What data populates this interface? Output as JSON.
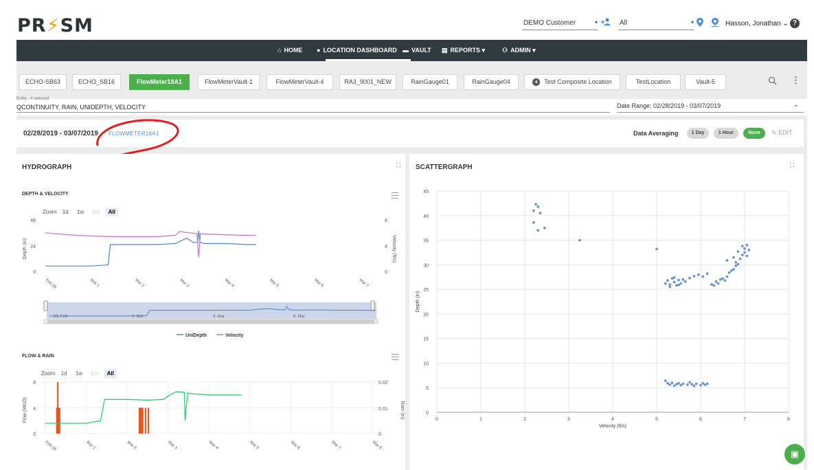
{
  "header": {
    "logo": "PR",
    "logo_bolt": "⚡",
    "logo_tail": "SM",
    "customer": "DEMO Customer",
    "filter": "All",
    "user": "Hasson, Jonathan",
    "user_caret": "⌄",
    "help": "?"
  },
  "nav": {
    "items": [
      {
        "label": "HOME",
        "icon": "home-icon"
      },
      {
        "label": "LOCATION DASHBOARD",
        "icon": "location-pin-icon"
      },
      {
        "label": "VAULT",
        "icon": "folder-icon"
      },
      {
        "label": "REPORTS",
        "icon": "report-icon"
      },
      {
        "label": "ADMIN",
        "icon": "admin-icon"
      }
    ]
  },
  "tabs": [
    "ECHO-SB63",
    "ECHO_SB16",
    "FlowMeter18A1",
    "FlowMeterVault-1",
    "FlowMeterVault-4",
    "RA3_9001_NEW",
    "RainGauge01",
    "RainGauge04",
    "Test Composite Location",
    "TestLocation",
    "Vault-5"
  ],
  "active_tab": "FlowMeter18A1",
  "entity": {
    "label": "Entity : 4 selected",
    "value": "QCONTINUITY, RAIN, UNIDEPTH, VELOCITY"
  },
  "date_range_field": "Date Range: 02/28/2019 - 03/07/2019",
  "infobar": {
    "date": "02/28/2019 - 03/07/2019",
    "location": "FLOWMETER18A1",
    "averaging_label": "Data Averaging",
    "pills": [
      "1 Day",
      "1 Hour",
      "None"
    ],
    "active_pill": "None",
    "edit": "EDIT"
  },
  "hydrograph": {
    "title": "HYDROGRAPH",
    "depth_velocity": {
      "title": "DEPTH & VELOCITY",
      "zoom_label": "Zoom",
      "zoom_options": [
        "1d",
        "1w",
        "1m",
        "All"
      ],
      "y_left_label": "Depth (in)",
      "y_right_label": "Velocity (ft/s)",
      "y_left_ticks": [
        "48",
        "24",
        "0"
      ],
      "y_right_ticks": [
        "8",
        "4",
        "0"
      ],
      "x_ticks": [
        "Feb 28",
        "Mar 1",
        "Mar 2",
        "Mar 3",
        "Mar 4",
        "Mar 5",
        "Mar 6",
        "Mar 7"
      ],
      "navigator_labels": [
        "28. Feb",
        "2. Mar",
        "4. Mar",
        "6. Mar"
      ],
      "legend": [
        "UniDepth",
        "Velocity"
      ]
    },
    "flow_rain": {
      "title": "FLOW & RAIN",
      "zoom_label": "Zoom",
      "zoom_options": [
        "1d",
        "1w",
        "1m",
        "All"
      ],
      "y_left_label": "Flow (MGD)",
      "y_right_label": "Rain (in)",
      "y_left_ticks": [
        "8",
        "4",
        "0"
      ],
      "y_right_ticks": [
        "0.02",
        "0.01",
        "0"
      ],
      "x_ticks": [
        "Feb 28",
        "Mar 1",
        "Mar 2",
        "Mar 3",
        "Mar 4",
        "Mar 5",
        "Mar 6",
        "Mar 7",
        "Mar 8"
      ]
    }
  },
  "scattergraph": {
    "title": "SCATTERGRAPH"
  },
  "colors": {
    "depth": "#4a86c8",
    "velocity": "#c86ec8",
    "flow": "#2ecc71",
    "rain": "#e8541e",
    "scatter": "#6f94c9",
    "green": "#4cae4c",
    "nav": "#2f3b41"
  },
  "chart_data": [
    {
      "type": "line",
      "title": "DEPTH & VELOCITY",
      "xlabel": "",
      "ylabel": "Depth (in)",
      "y2label": "Velocity (ft/s)",
      "x_ticks": [
        "Feb 28",
        "Mar 1",
        "Mar 2",
        "Mar 3",
        "Mar 4",
        "Mar 5",
        "Mar 6",
        "Mar 7"
      ],
      "ylim": [
        0,
        48
      ],
      "y2lim": [
        0,
        8
      ],
      "series": [
        {
          "name": "UniDepth",
          "axis": "left",
          "x": [
            0,
            0.5,
            1.0,
            1.4,
            1.45,
            2.0,
            2.5,
            2.9,
            3.0,
            3.15,
            3.3,
            3.4,
            3.42,
            3.45,
            3.55,
            4.0,
            4.5,
            4.7
          ],
          "y": [
            5,
            5,
            5,
            6,
            25,
            25,
            25,
            26,
            28,
            31,
            27,
            27,
            38,
            27,
            26,
            26,
            25,
            25
          ]
        },
        {
          "name": "Velocity",
          "axis": "right",
          "x": [
            0,
            0.5,
            1.0,
            1.5,
            2.0,
            2.5,
            2.9,
            3.0,
            3.2,
            3.38,
            3.42,
            3.46,
            3.55,
            4.0,
            4.5,
            4.7
          ],
          "y": [
            6.0,
            5.7,
            5.5,
            5.4,
            5.4,
            5.4,
            5.6,
            6.2,
            6.0,
            5.9,
            2.2,
            5.9,
            5.8,
            5.7,
            5.6,
            5.6
          ]
        }
      ]
    },
    {
      "type": "line",
      "title": "FLOW & RAIN",
      "xlabel": "",
      "ylabel": "Flow (MGD)",
      "y2label": "Rain (in)",
      "x_ticks": [
        "Feb 28",
        "Mar 1",
        "Mar 2",
        "Mar 3",
        "Mar 4",
        "Mar 5",
        "Mar 6",
        "Mar 7",
        "Mar 8"
      ],
      "ylim": [
        0,
        8
      ],
      "y2lim": [
        0,
        0.02
      ],
      "series": [
        {
          "name": "Flow",
          "axis": "left",
          "x": [
            0,
            0.5,
            1.0,
            1.35,
            1.45,
            2.0,
            2.5,
            2.9,
            3.0,
            3.2,
            3.4,
            3.42,
            3.48,
            3.55,
            4.0,
            4.5,
            4.8
          ],
          "y": [
            1.6,
            1.6,
            1.6,
            2.0,
            5.3,
            5.3,
            5.2,
            5.3,
            5.8,
            6.5,
            6.4,
            2.0,
            6.3,
            6.2,
            6.0,
            6.0,
            6.0
          ]
        },
        {
          "name": "Rain",
          "type": "bar",
          "axis": "right",
          "x": [
            0.28,
            0.3,
            0.32,
            0.35,
            2.3,
            2.33,
            2.36,
            2.38,
            2.45,
            2.52
          ],
          "y": [
            0.01,
            0.02,
            0.01,
            0.01,
            0.01,
            0.01,
            0.01,
            0.01,
            0.01,
            0.01
          ]
        }
      ]
    },
    {
      "type": "scatter",
      "title": "SCATTERGRAPH",
      "xlabel": "Velocity (ft/s)",
      "ylabel": "Depth (in)",
      "xlim": [
        0,
        8
      ],
      "ylim": [
        0,
        45
      ],
      "x_ticks": [
        "0",
        "1",
        "2",
        "3",
        "4",
        "5",
        "6",
        "7",
        "8"
      ],
      "y_ticks": [
        "45",
        "40",
        "35",
        "30",
        "25",
        "20",
        "15",
        "10",
        "5",
        "0"
      ],
      "series": [
        {
          "name": "",
          "points": [
            [
              2.25,
              42.3
            ],
            [
              2.3,
              41.8
            ],
            [
              2.2,
              41.0
            ],
            [
              2.35,
              40.5
            ],
            [
              2.2,
              38.6
            ],
            [
              2.45,
              37.5
            ],
            [
              2.3,
              37.0
            ],
            [
              3.25,
              35.0
            ],
            [
              5.0,
              33.2
            ],
            [
              5.2,
              26.2
            ],
            [
              5.25,
              26.8
            ],
            [
              5.3,
              26.0
            ],
            [
              5.35,
              27.2
            ],
            [
              5.4,
              26.5
            ],
            [
              5.45,
              25.8
            ],
            [
              5.5,
              26.9
            ],
            [
              5.55,
              26.2
            ],
            [
              5.6,
              27.0
            ],
            [
              5.3,
              25.5
            ],
            [
              5.4,
              27.4
            ],
            [
              5.5,
              25.9
            ],
            [
              5.65,
              26.6
            ],
            [
              5.75,
              27.3
            ],
            [
              5.85,
              27.7
            ],
            [
              5.95,
              28.0
            ],
            [
              6.05,
              27.6
            ],
            [
              6.15,
              28.2
            ],
            [
              6.25,
              26.0
            ],
            [
              6.3,
              25.8
            ],
            [
              6.35,
              26.6
            ],
            [
              6.4,
              26.2
            ],
            [
              6.45,
              27.0
            ],
            [
              6.5,
              27.2
            ],
            [
              6.55,
              26.8
            ],
            [
              6.6,
              27.6
            ],
            [
              6.65,
              28.4
            ],
            [
              6.7,
              28.8
            ],
            [
              6.75,
              29.1
            ],
            [
              6.8,
              29.8
            ],
            [
              6.85,
              30.1
            ],
            [
              6.8,
              30.5
            ],
            [
              6.9,
              31.2
            ],
            [
              6.95,
              32.0
            ],
            [
              7.0,
              32.5
            ],
            [
              7.05,
              31.8
            ],
            [
              7.1,
              33.0
            ],
            [
              6.95,
              33.8
            ],
            [
              7.05,
              34.0
            ],
            [
              6.75,
              31.5
            ],
            [
              6.85,
              32.7
            ],
            [
              7.0,
              33.3
            ],
            [
              6.6,
              30.9
            ],
            [
              5.2,
              6.4
            ],
            [
              5.25,
              5.9
            ],
            [
              5.3,
              5.6
            ],
            [
              5.35,
              6.0
            ],
            [
              5.4,
              5.4
            ],
            [
              5.45,
              5.7
            ],
            [
              5.5,
              5.9
            ],
            [
              5.55,
              5.5
            ],
            [
              5.6,
              5.8
            ],
            [
              5.7,
              5.6
            ],
            [
              5.75,
              6.1
            ],
            [
              5.8,
              5.7
            ],
            [
              5.85,
              5.4
            ],
            [
              5.9,
              5.8
            ],
            [
              6.0,
              5.5
            ],
            [
              6.05,
              5.9
            ],
            [
              6.1,
              5.6
            ],
            [
              6.15,
              5.8
            ]
          ]
        }
      ]
    }
  ]
}
